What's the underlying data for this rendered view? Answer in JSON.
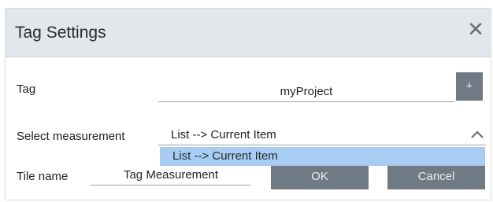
{
  "dialog": {
    "title": "Tag Settings",
    "close_label": "✕"
  },
  "tag": {
    "label": "Tag",
    "value": "myProject",
    "add_label": "+"
  },
  "measurement": {
    "label": "Select measurement",
    "value": "List --> Current Item",
    "options": [
      "List --> Current Item"
    ]
  },
  "tile": {
    "label": "Tile name",
    "value": "Tag Measurement"
  },
  "buttons": {
    "ok": "OK",
    "cancel": "Cancel"
  },
  "colors": {
    "header_bg": "#e3e6ea",
    "button_bg": "#6f7a84",
    "option_highlight": "#a9ccf2"
  }
}
